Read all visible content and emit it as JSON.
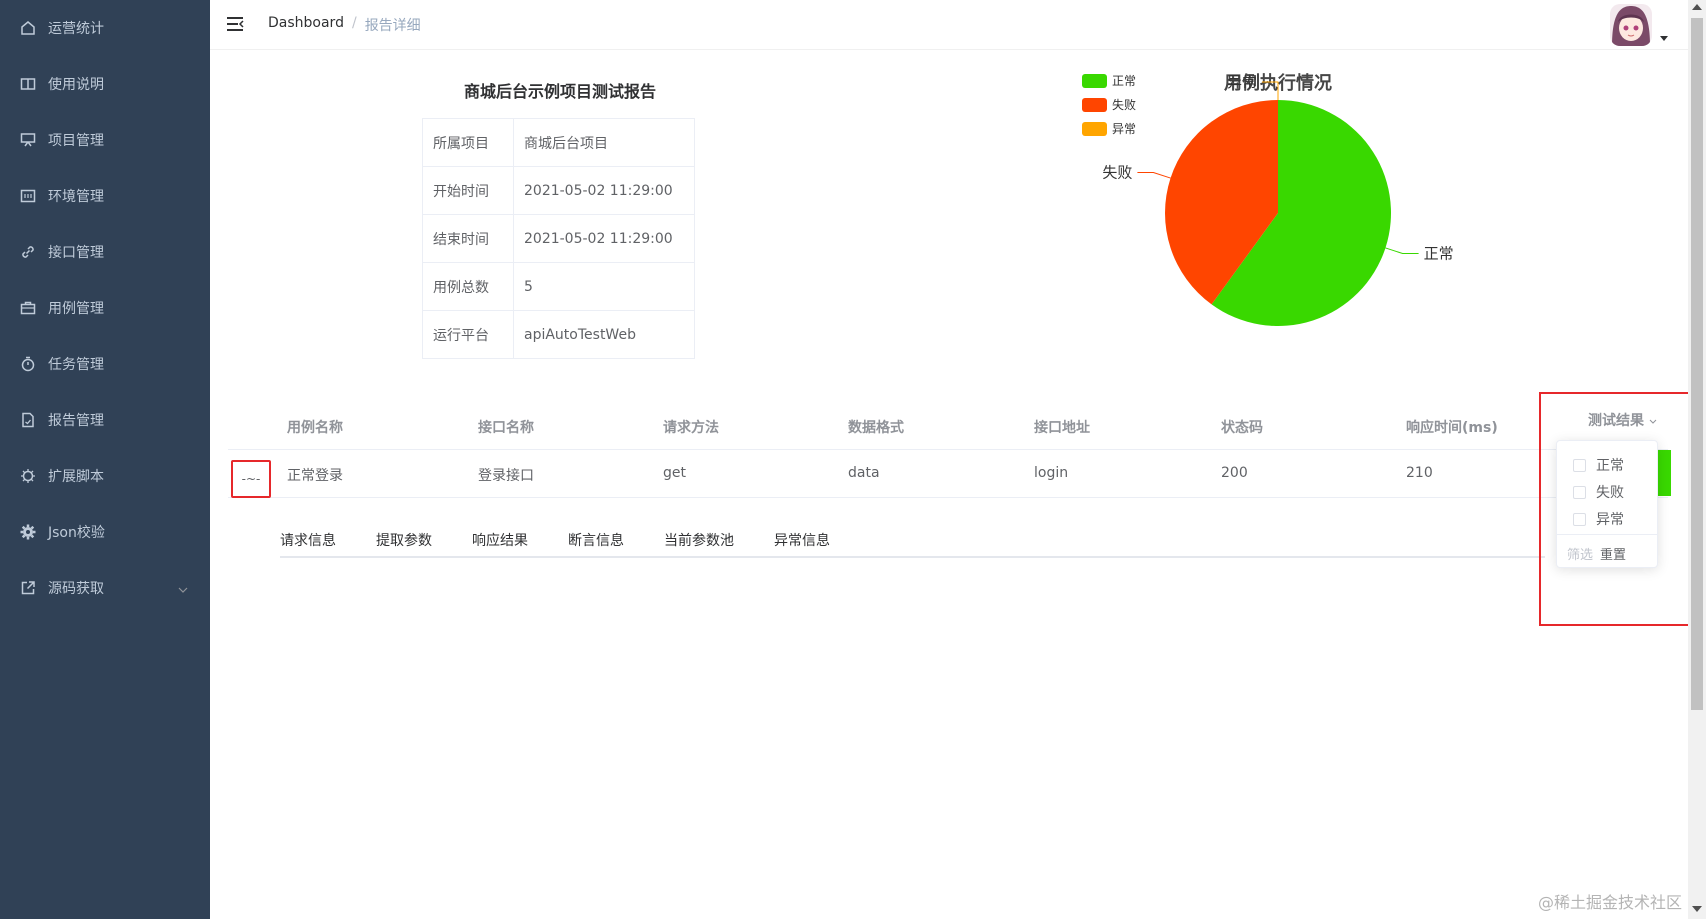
{
  "sidebar": {
    "items": [
      {
        "label": "运营统计",
        "icon": "home-icon"
      },
      {
        "label": "使用说明",
        "icon": "book-icon"
      },
      {
        "label": "项目管理",
        "icon": "presentation-icon"
      },
      {
        "label": "环境管理",
        "icon": "terminal-icon"
      },
      {
        "label": "接口管理",
        "icon": "link-icon"
      },
      {
        "label": "用例管理",
        "icon": "briefcase-icon"
      },
      {
        "label": "任务管理",
        "icon": "stopwatch-icon"
      },
      {
        "label": "报告管理",
        "icon": "document-icon"
      },
      {
        "label": "扩展脚本",
        "icon": "cpu-icon"
      },
      {
        "label": "Json校验",
        "icon": "gear-icon"
      },
      {
        "label": "源码获取",
        "icon": "external-link-icon"
      }
    ]
  },
  "header": {
    "breadcrumb": {
      "home": "Dashboard",
      "separator": "/",
      "current": "报告详细"
    }
  },
  "report": {
    "title": "商城后台示例项目测试报告",
    "info": [
      {
        "key": "所属项目",
        "value": "商城后台项目"
      },
      {
        "key": "开始时间",
        "value": "2021-05-02 11:29:00"
      },
      {
        "key": "结束时间",
        "value": "2021-05-02 11:29:00"
      },
      {
        "key": "用例总数",
        "value": "5"
      },
      {
        "key": "运行平台",
        "value": "apiAutoTestWeb"
      }
    ]
  },
  "chart_data": {
    "type": "pie",
    "title": "用例执行情况",
    "legend_position": "top-left",
    "series": [
      {
        "name": "正常",
        "value": 3,
        "color": "#39d800"
      },
      {
        "name": "失败",
        "value": 2,
        "color": "#ff4500"
      },
      {
        "name": "异常",
        "value": 0,
        "color": "#ffa500"
      }
    ]
  },
  "table": {
    "headers": [
      "用例名称",
      "接口名称",
      "请求方法",
      "数据格式",
      "接口地址",
      "状态码",
      "响应时间(ms)",
      "测试结果"
    ],
    "rows": [
      {
        "case_name": "正常登录",
        "api_name": "登录接口",
        "method": "get",
        "format": "data",
        "url": "login",
        "status": "200",
        "time": "210",
        "result_color": "#39d800"
      }
    ],
    "expand_icon": "-~-"
  },
  "tabs": [
    "请求信息",
    "提取参数",
    "响应结果",
    "断言信息",
    "当前参数池",
    "异常信息"
  ],
  "filter": {
    "options": [
      "正常",
      "失败",
      "异常"
    ],
    "confirm": "筛选",
    "reset": "重置"
  },
  "watermark": "@稀土掘金技术社区"
}
